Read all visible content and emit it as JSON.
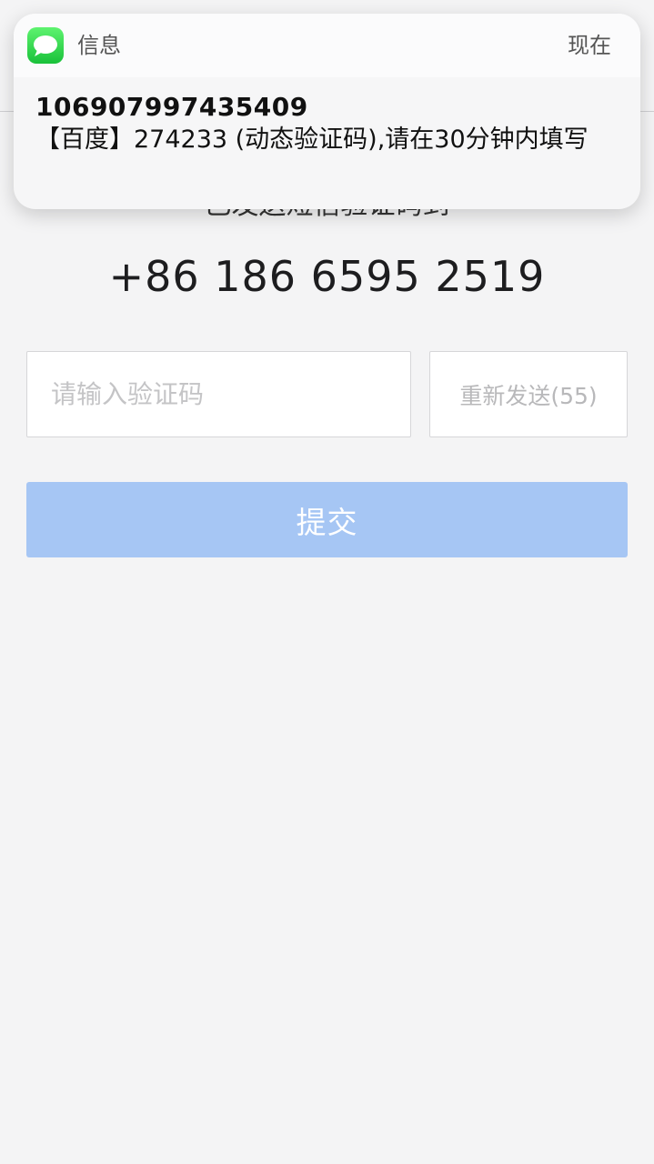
{
  "notification": {
    "app_name": "信息",
    "time": "现在",
    "sender": "106907997435409",
    "message": "【百度】274233 (动态验证码),请在30分钟内填写",
    "app_icon": "messages-bubble-icon",
    "icon_color": "#34c759"
  },
  "page": {
    "sent_hint": "已发送短信验证码到",
    "phone_number": "+86 186 6595 2519",
    "code_input": {
      "placeholder": "请输入验证码",
      "value": ""
    },
    "resend_label": "重新发送(55)",
    "submit_label": "提交",
    "submit_color": "#a6c6f4",
    "background_color": "#f4f4f5"
  }
}
